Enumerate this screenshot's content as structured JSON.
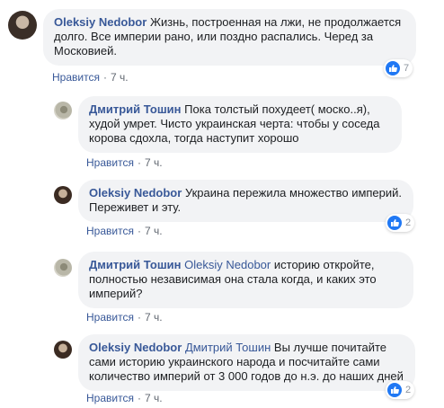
{
  "comments": [
    {
      "author": "Oleksiy Nedobor",
      "mention": "",
      "text": "Жизнь, построенная на лжи, не продолжается долго. Все империи рано, или поздно распались. Черед за Московией.",
      "like_label": "Нравится",
      "time": "7 ч.",
      "reaction_count": "7"
    },
    {
      "author": "Дмитрий Тошин",
      "mention": "",
      "text": "Пока толстый похудеет( моско..я), худой умрет. Чисто украинская черта: чтобы у соседа корова сдохла, тогда наступит хорошо",
      "like_label": "Нравится",
      "time": "7 ч."
    },
    {
      "author": "Oleksiy Nedobor",
      "mention": "",
      "text": "Украина пережила множество империй. Переживет и эту.",
      "like_label": "Нравится",
      "time": "7 ч.",
      "reaction_count": "2"
    },
    {
      "author": "Дмитрий Тошин",
      "mention": "Oleksiy Nedobor",
      "text": "историю откройте, полностью независимая она стала когда, и каких это империй?",
      "like_label": "Нравится",
      "time": "7 ч."
    },
    {
      "author": "Oleksiy Nedobor",
      "mention": "Дмитрий Тошин",
      "text": "Вы лучше почитайте сами историю украинского народа и посчитайте сами количество империй от 3 000 годов до н.э. до наших дней",
      "like_label": "Нравится",
      "time": "7 ч.",
      "reaction_count": "2"
    }
  ],
  "colors": {
    "link": "#385898",
    "bubble": "#f2f3f5",
    "like_blue": "#2078f4"
  },
  "icons": {
    "like": "thumbs-up-icon"
  }
}
